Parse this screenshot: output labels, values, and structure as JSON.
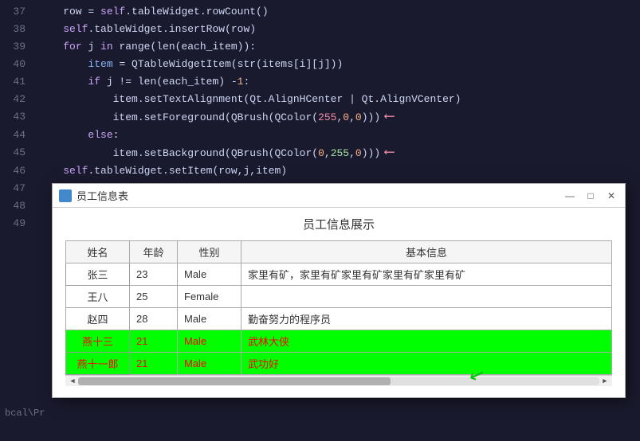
{
  "editor": {
    "background": "#1a1a2e",
    "lines": [
      {
        "number": "37",
        "content": "    row = self.tableWidget.rowCount()",
        "parts": [
          {
            "text": "    row = ",
            "class": ""
          },
          {
            "text": "self",
            "class": "self-kw"
          },
          {
            "text": ".tableWidget.rowCount()",
            "class": ""
          }
        ]
      },
      {
        "number": "38",
        "content": "    self.tableWidget.insertRow(row)",
        "parts": []
      },
      {
        "number": "39",
        "content": "    for j in range(len(each_item)):",
        "parts": []
      },
      {
        "number": "40",
        "content": "        item = QTableWidgetItem(str(items[i][j]))",
        "parts": []
      },
      {
        "number": "41",
        "content": "        if j != len(each_item) -1:",
        "parts": []
      },
      {
        "number": "42",
        "content": "            item.setTextAlignment(Qt.AlignHCenter | Qt.AlignVCenter)",
        "parts": []
      },
      {
        "number": "43",
        "content": "            item.setForeground(QBrush(QColor(255,0,0)))",
        "parts": [],
        "arrow": true
      },
      {
        "number": "44",
        "content": "        else:",
        "parts": []
      },
      {
        "number": "45",
        "content": "            item.setBackground(QBrush(QColor(0,255,0)))",
        "parts": [],
        "arrow": true
      },
      {
        "number": "46",
        "content": "    self.tableWidget.setItem(row,j,item)",
        "parts": []
      },
      {
        "number": "47",
        "content": "",
        "parts": []
      }
    ]
  },
  "dialog": {
    "title": "员工信息表",
    "heading": "员工信息展示",
    "controls": {
      "minimize": "—",
      "maximize": "□",
      "close": "✕"
    },
    "table": {
      "headers": [
        "姓名",
        "年龄",
        "性别",
        "基本信息"
      ],
      "rows": [
        {
          "name": "张三",
          "age": "23",
          "gender": "Male",
          "info": "家里有矿，家里有矿家里有矿家里有矿家里有矿",
          "type": "normal"
        },
        {
          "name": "王八",
          "age": "25",
          "gender": "Female",
          "info": "",
          "type": "normal"
        },
        {
          "name": "赵四",
          "age": "28",
          "gender": "Male",
          "info": "勤奋努力的程序员",
          "type": "normal"
        },
        {
          "name": "燕十三",
          "age": "21",
          "gender": "Male",
          "info": "武林大侠",
          "type": "green-red"
        },
        {
          "name": "燕十一郎",
          "age": "21",
          "gender": "Male",
          "info": "武功好",
          "type": "green-red"
        }
      ]
    }
  },
  "statusbar": {
    "left_text": "bcal\\Pr"
  }
}
